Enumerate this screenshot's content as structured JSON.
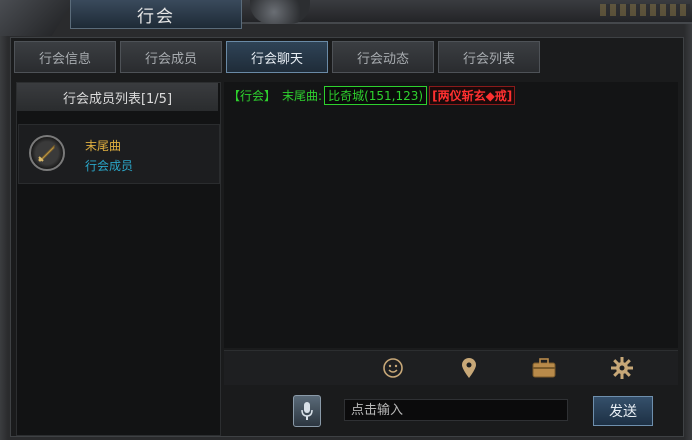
{
  "window": {
    "title": "行会"
  },
  "tabs": [
    {
      "label": "行会信息",
      "active": false
    },
    {
      "label": "行会成员",
      "active": false
    },
    {
      "label": "行会聊天",
      "active": true
    },
    {
      "label": "行会动态",
      "active": false
    },
    {
      "label": "行会列表",
      "active": false
    }
  ],
  "sidebar": {
    "title": "行会成员列表[1/5]",
    "members": [
      {
        "name": "末尾曲",
        "role": "行会成员",
        "icon": "sword-icon"
      }
    ]
  },
  "chat": {
    "messages": [
      {
        "channel": "【行会】",
        "sender": "末尾曲:",
        "location_name": "比奇城",
        "location_coords": "(151,123)",
        "item": "[两仪斩玄◆戒]"
      }
    ]
  },
  "toolbar": {
    "icons": [
      "smiley-icon",
      "location-pin-icon",
      "briefcase-icon",
      "gear-icon"
    ]
  },
  "input": {
    "placeholder": "点击输入",
    "value": "",
    "send_label": "发送"
  },
  "colors": {
    "channel_green": "#2ed12e",
    "member_name": "#e0b040",
    "member_role": "#2aa6c8",
    "item_red": "#ff3030"
  }
}
